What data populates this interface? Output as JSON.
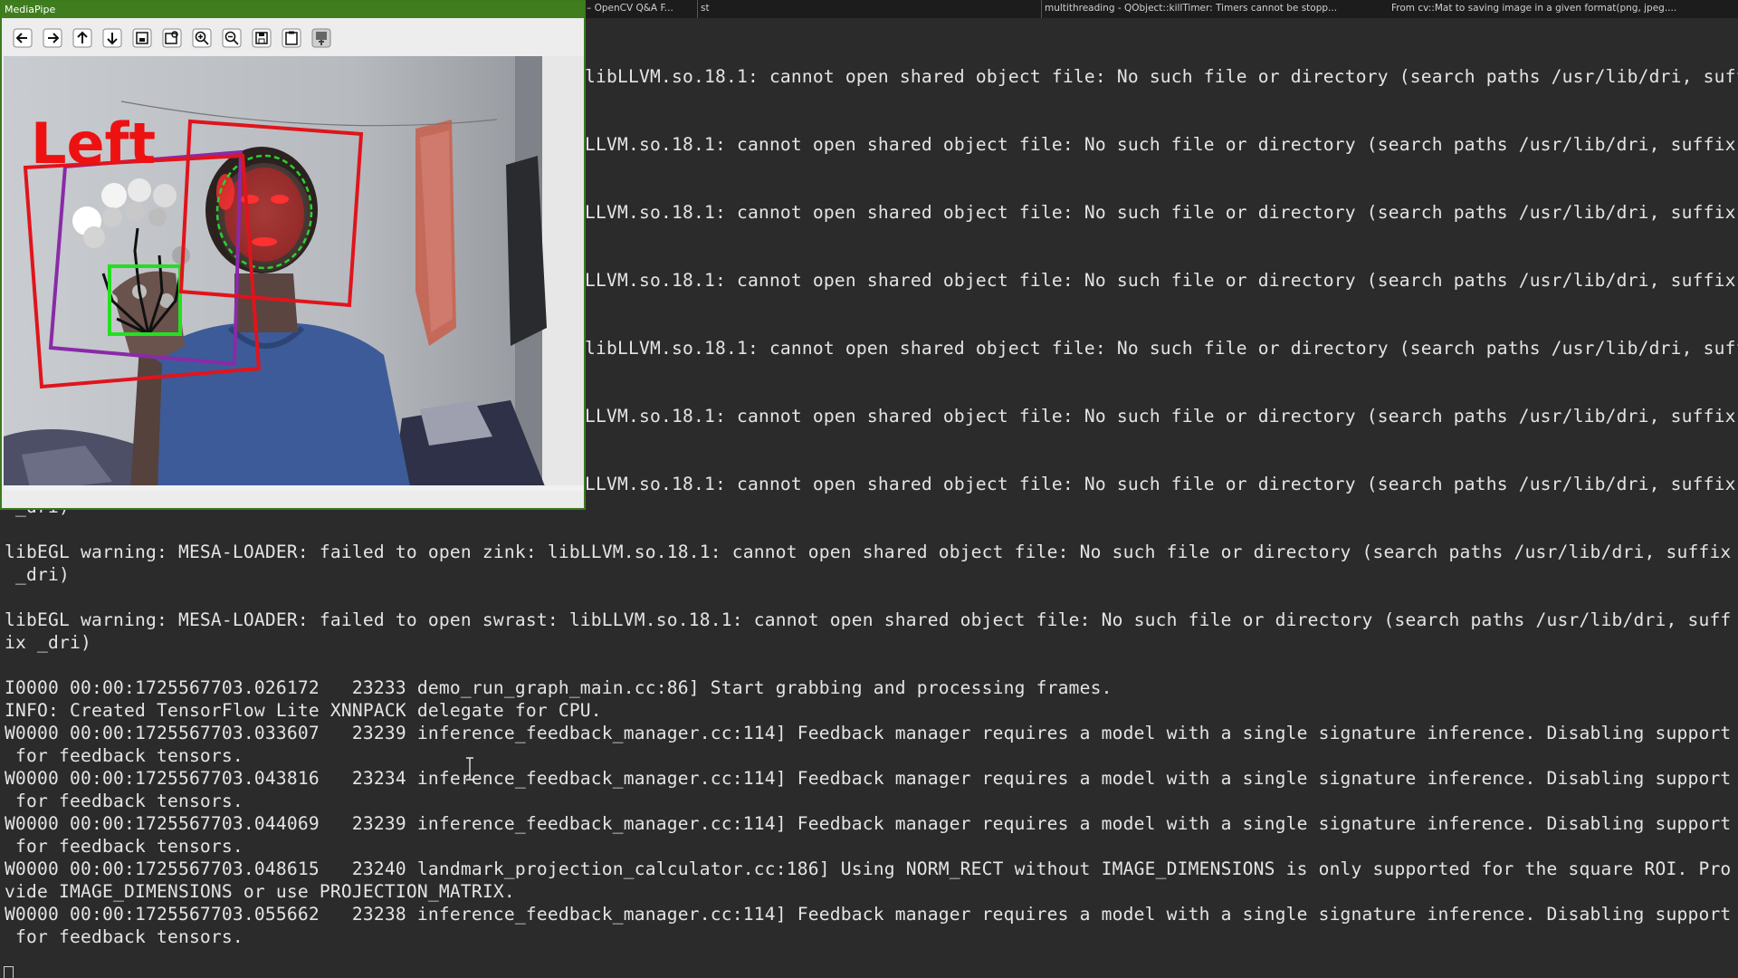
{
  "topbar": {
    "tab1": "– OpenCV Q&A F...",
    "tab2": "st",
    "tab3": "multithreading - QObject::killTimer: Timers cannot be stopp...",
    "tab4": "From cv::Mat to saving image in a given format(png, jpeg...."
  },
  "mediapipe": {
    "title": "MediaPipe",
    "hand_label": "Left",
    "toolbar": [
      {
        "name": "back",
        "icon": "arrow-left-icon"
      },
      {
        "name": "forward",
        "icon": "arrow-right-icon"
      },
      {
        "name": "up",
        "icon": "arrow-up-icon"
      },
      {
        "name": "down",
        "icon": "arrow-down-icon"
      },
      {
        "name": "zoom-fit",
        "icon": "zoom-fit-icon"
      },
      {
        "name": "zoom-original",
        "icon": "zoom-original-icon"
      },
      {
        "name": "zoom-in",
        "icon": "zoom-in-icon"
      },
      {
        "name": "zoom-out",
        "icon": "zoom-out-icon"
      },
      {
        "name": "save",
        "icon": "save-icon"
      },
      {
        "name": "copy",
        "icon": "copy-icon"
      },
      {
        "name": "properties",
        "icon": "properties-icon"
      }
    ]
  },
  "terminal": {
    "lines": [
      "libLLVM.so.18.1: cannot open shared object file: No such file or directory (search paths /usr/lib/dri, suff",
      "LLVM.so.18.1: cannot open shared object file: No such file or directory (search paths /usr/lib/dri, suffix",
      "LLVM.so.18.1: cannot open shared object file: No such file or directory (search paths /usr/lib/dri, suffix",
      "LLVM.so.18.1: cannot open shared object file: No such file or directory (search paths /usr/lib/dri, suffix",
      "libLLVM.so.18.1: cannot open shared object file: No such file or directory (search paths /usr/lib/dri, suff",
      "LLVM.so.18.1: cannot open shared object file: No such file or directory (search paths /usr/lib/dri, suffix",
      "LLVM.so.18.1: cannot open shared object file: No such file or directory (search paths /usr/lib/dri, suffix",
      " _dri)",
      "libEGL warning: MESA-LOADER: failed to open zink: libLLVM.so.18.1: cannot open shared object file: No such file or directory (search paths /usr/lib/dri, suffix",
      " _dri)",
      "libEGL warning: MESA-LOADER: failed to open swrast: libLLVM.so.18.1: cannot open shared object file: No such file or directory (search paths /usr/lib/dri, suff",
      "ix _dri)",
      "I0000 00:00:1725567703.026172   23233 demo_run_graph_main.cc:86] Start grabbing and processing frames.",
      "INFO: Created TensorFlow Lite XNNPACK delegate for CPU.",
      "W0000 00:00:1725567703.033607   23239 inference_feedback_manager.cc:114] Feedback manager requires a model with a single signature inference. Disabling support",
      " for feedback tensors.",
      "W0000 00:00:1725567703.043816   23234 inference_feedback_manager.cc:114] Feedback manager requires a model with a single signature inference. Disabling support",
      " for feedback tensors.",
      "W0000 00:00:1725567703.044069   23239 inference_feedback_manager.cc:114] Feedback manager requires a model with a single signature inference. Disabling support",
      " for feedback tensors.",
      "W0000 00:00:1725567703.048615   23240 landmark_projection_calculator.cc:186] Using NORM_RECT without IMAGE_DIMENSIONS is only supported for the square ROI. Pro",
      "vide IMAGE_DIMENSIONS or use PROJECTION_MATRIX.",
      "W0000 00:00:1725567703.055662   23238 inference_feedback_manager.cc:114] Feedback manager requires a model with a single signature inference. Disabling support",
      " for feedback tensors."
    ]
  }
}
